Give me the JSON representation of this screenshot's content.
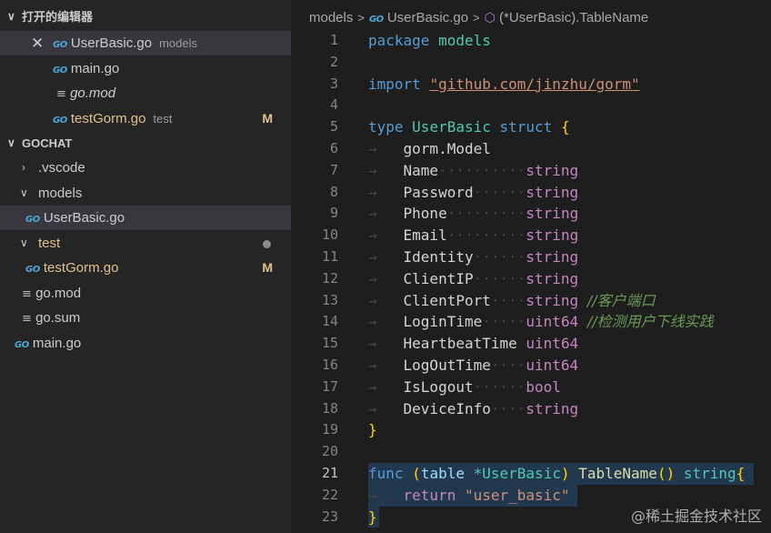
{
  "sidebar": {
    "open_editors_title": "打开的编辑器",
    "open_editors": [
      {
        "name": "UserBasic.go",
        "desc": "models"
      },
      {
        "name": "main.go"
      },
      {
        "name": "go.mod"
      },
      {
        "name": "testGorm.go",
        "desc": "test",
        "badge": "M"
      }
    ],
    "workspace_title": "GOCHAT",
    "tree": {
      "vscode": ".vscode",
      "models": "models",
      "userbasic": "UserBasic.go",
      "test": "test",
      "testgorm": "testGorm.go",
      "testgorm_badge": "M",
      "gomod": "go.mod",
      "gosum": "go.sum",
      "maingo": "main.go"
    }
  },
  "breadcrumb": {
    "folder": "models",
    "file": "UserBasic.go",
    "symbol": "(*UserBasic).TableName"
  },
  "editor": {
    "active_line": 21,
    "line_numbers": [
      "1",
      "2",
      "3",
      "4",
      "5",
      "6",
      "7",
      "8",
      "9",
      "10",
      "11",
      "12",
      "13",
      "14",
      "15",
      "16",
      "17",
      "18",
      "19",
      "20",
      "21",
      "22",
      "23"
    ],
    "code": {
      "package_kw": "package",
      "package_name": "models",
      "import_kw": "import",
      "import_path": "\"github.com/jinzhu/gorm\"",
      "type_kw": "type",
      "struct_name": "UserBasic",
      "struct_kw": "struct",
      "embed": "gorm.Model",
      "fields": [
        {
          "name": "Name",
          "type": "string"
        },
        {
          "name": "Password",
          "type": "string"
        },
        {
          "name": "Phone",
          "type": "string"
        },
        {
          "name": "Email",
          "type": "string"
        },
        {
          "name": "Identity",
          "type": "string"
        },
        {
          "name": "ClientIP",
          "type": "string"
        },
        {
          "name": "ClientPort",
          "type": "string",
          "comment": "//客户端口"
        },
        {
          "name": "LoginTime",
          "type": "uint64",
          "comment": "//检测用户下线实践"
        },
        {
          "name": "HeartbeatTime",
          "type": "uint64"
        },
        {
          "name": "LogOutTime",
          "type": "uint64"
        },
        {
          "name": "IsLogout",
          "type": "bool"
        },
        {
          "name": "DeviceInfo",
          "type": "string"
        }
      ],
      "func_kw": "func",
      "receiver_name": "table",
      "receiver_type": "*UserBasic",
      "method_name": "TableName",
      "return_type": "string",
      "return_kw": "return",
      "return_value": "\"user_basic\""
    }
  },
  "watermark": "@稀土掘金技术社区",
  "colors": {
    "sidebar_bg": "#252526",
    "editor_bg": "#1e1e1e",
    "selection": "#264f78",
    "modified": "#e2c08d"
  }
}
